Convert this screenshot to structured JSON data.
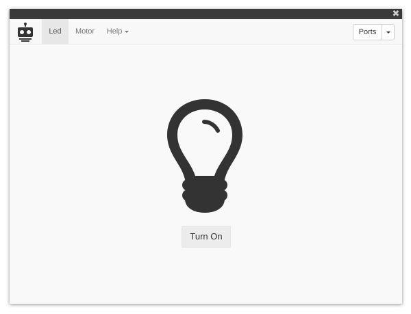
{
  "window": {
    "close_glyph": "✖"
  },
  "navbar": {
    "brand_icon": "robot-icon",
    "items": [
      {
        "label": "Led",
        "active": true
      },
      {
        "label": "Motor",
        "active": false
      },
      {
        "label": "Help",
        "dropdown": true
      }
    ],
    "ports_label": "Ports"
  },
  "main": {
    "icon": "lightbulb-icon",
    "button_label": "Turn On"
  },
  "colors": {
    "titlebar": "#3a3a3a",
    "navbar_bg": "#f8f8f8",
    "active_tab_bg": "#e7e7e7",
    "icon_fill": "#333333"
  }
}
